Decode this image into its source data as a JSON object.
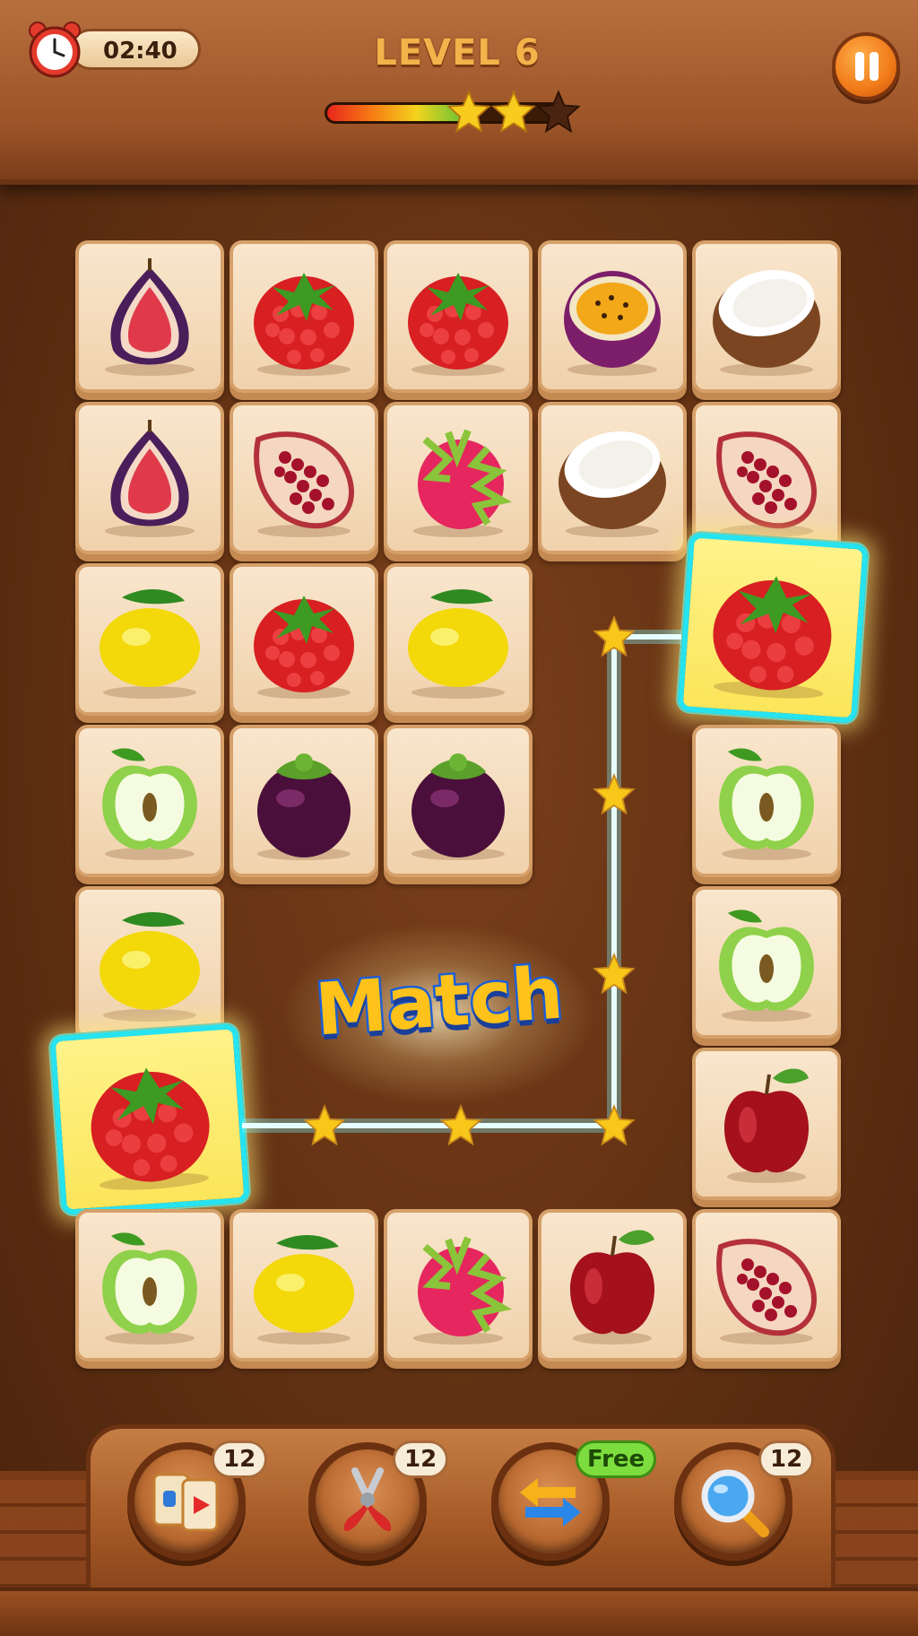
{
  "header": {
    "timer": "02:40",
    "level_title": "LEVEL 6",
    "progress_fraction": 0.63,
    "stars_earned": 2,
    "stars_total": 3
  },
  "board": {
    "tiles": [
      [
        "fig",
        "raspberry",
        "raspberry",
        "passion-fruit",
        "coconut"
      ],
      [
        "fig",
        "pomegranate",
        "dragon-fruit",
        "coconut",
        "pomegranate"
      ],
      [
        "lemon",
        "raspberry",
        "lemon",
        "",
        "raspberry"
      ],
      [
        "green-apple",
        "mangosteen",
        "mangosteen",
        "",
        "green-apple"
      ],
      [
        "lemon",
        "",
        "",
        "",
        "green-apple"
      ],
      [
        "raspberry",
        "",
        "",
        "",
        "red-apple"
      ],
      [
        "green-apple",
        "lemon",
        "dragon-fruit",
        "red-apple",
        "pomegranate"
      ]
    ],
    "selected_tiles": [
      "raspberry-right",
      "raspberry-left"
    ],
    "match_label": "Match"
  },
  "toolbar": {
    "items": [
      {
        "name": "swap-cards",
        "count": "12"
      },
      {
        "name": "pliers",
        "count": "12"
      },
      {
        "name": "shuffle-arrows",
        "count": "Free"
      },
      {
        "name": "magnifier-hint",
        "count": "12"
      }
    ]
  },
  "colors": {
    "accent_glow": "#26e3f0",
    "match_text": "#ffc21a",
    "badge_free": "#7ddc3e"
  }
}
